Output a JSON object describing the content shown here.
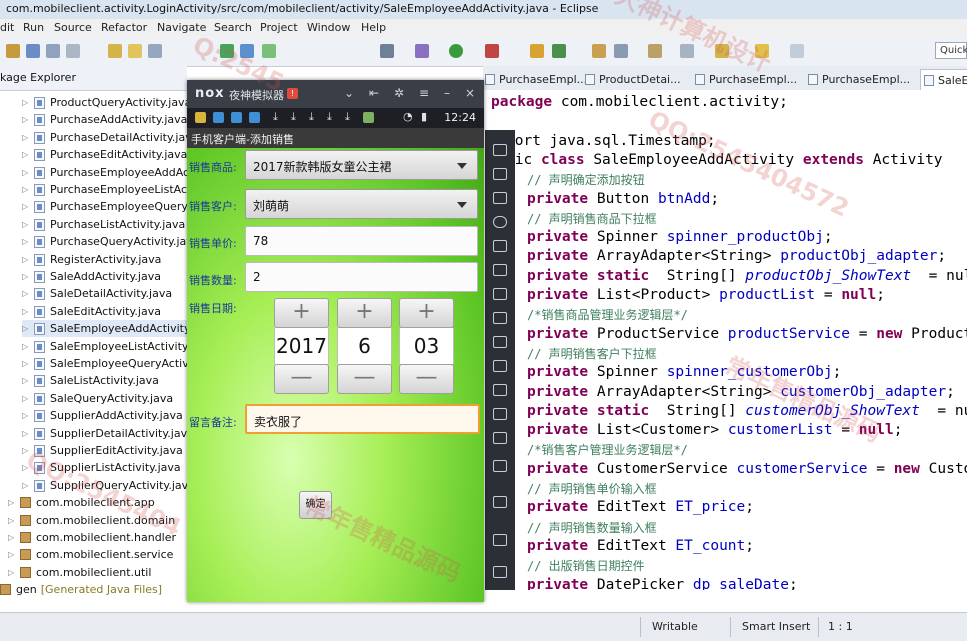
{
  "window": {
    "title": "com.mobileclient.activity.LoginActivity/src/com/mobileclient/activity/SaleEmployeeAddActivity.java - Eclipse"
  },
  "menu": [
    "dit",
    "Run",
    "Source",
    "Refactor",
    "Navigate",
    "Search",
    "Project",
    "Window",
    "Help"
  ],
  "toolbar": {
    "quick_access": "Quick"
  },
  "package_explorer": {
    "title": "kage Explorer",
    "files": [
      "ProductQueryActivity.java",
      "PurchaseAddActivity.java",
      "PurchaseDetailActivity.java",
      "PurchaseEditActivity.java",
      "PurchaseEmployeeAddAct",
      "PurchaseEmployeeListActiv",
      "PurchaseEmployeeQueryA",
      "PurchaseListActivity.java",
      "PurchaseQueryActivity.java",
      "RegisterActivity.java",
      "SaleAddActivity.java",
      "SaleDetailActivity.java",
      "SaleEditActivity.java",
      "SaleEmployeeAddActivity.j",
      "SaleEmployeeListActivity.ja",
      "SaleEmployeeQueryActivity",
      "SaleListActivity.java",
      "SaleQueryActivity.java",
      "SupplierAddActivity.java",
      "SupplierDetailActivity.java",
      "SupplierEditActivity.java",
      "SupplierListActivity.java",
      "SupplierQueryActivity.java"
    ],
    "packages": [
      "com.mobileclient.app",
      "com.mobileclient.domain",
      "com.mobileclient.handler",
      "com.mobileclient.service",
      "com.mobileclient.util"
    ],
    "gen": "gen",
    "gen_label": "[Generated Java Files]"
  },
  "editor_tabs": [
    "PurchaseEmpl...",
    "ProductDetai...",
    "PurchaseEmpl...",
    "PurchaseEmpl...",
    "SaleEm"
  ],
  "code": [
    "package com.mobileclient.activity;",
    "",
    "port java.sql.Timestamp;",
    "lic class SaleEmployeeAddActivity extends Activity",
    "// 声明确定添加按钮",
    "private Button btnAdd;",
    "// 声明销售商品下拉框",
    "private Spinner spinner_productObj;",
    "private ArrayAdapter<String> productObj_adapter;",
    "private static  String[] productObj_ShowText  = nul",
    "private List<Product> productList = null;",
    "/*销售商品管理业务逻辑层*/",
    "private ProductService productService = new Product",
    "// 声明销售客户下拉框",
    "private Spinner spinner_customerObj;",
    "private ArrayAdapter<String> customerObj_adapter;",
    "private static  String[] customerObj_ShowText  = nu",
    "private List<Customer> customerList = null;",
    "/*销售客户管理业务逻辑层*/",
    "private CustomerService customerService = new Custo",
    "// 声明销售单价输入框",
    "private EditText ET_price;",
    "// 声明销售数量输入框",
    "private EditText ET_count;",
    "// 出版销售日期控件",
    "private DatePicker dp saleDate;"
  ],
  "status": {
    "writable": "Writable",
    "insert_mode": "Smart Insert",
    "position": "1 : 1"
  },
  "emulator": {
    "logo": "nox",
    "name": "夜神模拟器",
    "time": "12:24",
    "app_title": "手机客户端-添加销售",
    "labels": {
      "product": "销售商品:",
      "customer": "销售客户:",
      "price": "销售单价:",
      "count": "销售数量:",
      "date": "销售日期:",
      "memo": "留言备注:"
    },
    "product_value": "2017新款韩版女童公主裙",
    "customer_value": "刘萌萌",
    "price_value": "78",
    "count_value": "2",
    "date": {
      "year": "2017",
      "month": "6",
      "day": "03",
      "plus": "+",
      "minus": "—"
    },
    "memo_value": "卖衣服了",
    "confirm": "确定"
  },
  "watermarks": [
    "大神计算机设计",
    "QQ:2545404572",
    "常年售精品源码",
    "Q:2545",
    "QQ:2545404",
    "常年售精品源码"
  ]
}
